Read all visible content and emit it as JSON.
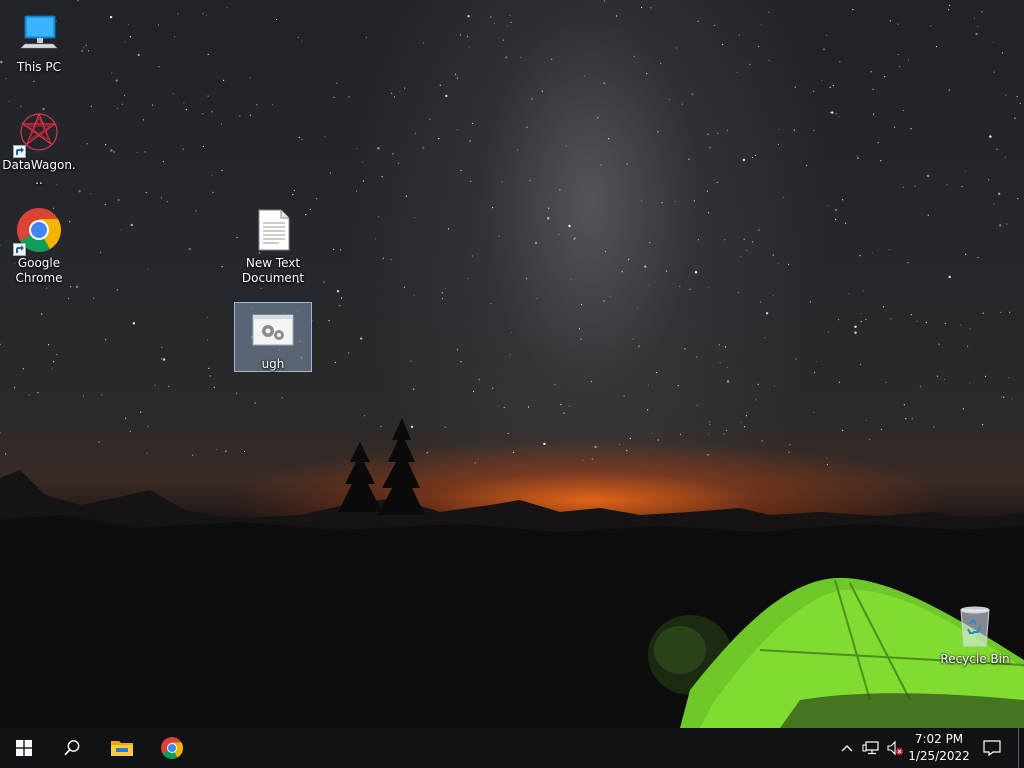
{
  "desktop": {
    "icons": [
      {
        "name": "this-pc",
        "label": "This PC"
      },
      {
        "name": "datawagon",
        "label": "DataWagon..."
      },
      {
        "name": "google-chrome",
        "label": "Google Chrome"
      },
      {
        "name": "new-text-document",
        "label": "New Text Document"
      },
      {
        "name": "ugh",
        "label": "ugh"
      },
      {
        "name": "recycle-bin",
        "label": "Recycle Bin"
      }
    ]
  },
  "taskbar": {
    "clock": {
      "time": "7:02 PM",
      "date": "1/25/2022"
    }
  },
  "colors": {
    "taskbar_bg": "#101215",
    "selection": "#96afcd",
    "tent_green": "#7fd72a"
  }
}
